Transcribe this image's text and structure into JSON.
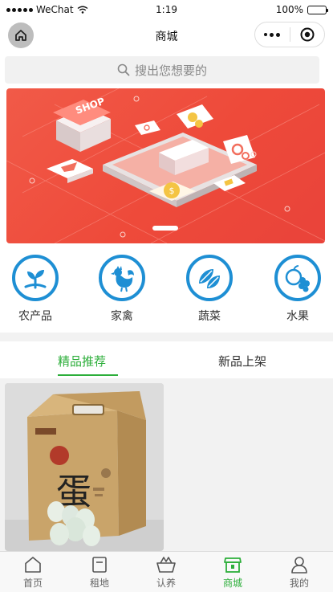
{
  "status_bar": {
    "carrier": "WeChat",
    "time": "1:19",
    "battery": "100%"
  },
  "nav": {
    "title": "商城"
  },
  "search": {
    "placeholder": "搜出您想要的"
  },
  "banner": {
    "sign_text": "SHOP",
    "page_count": 1,
    "active_page": 1
  },
  "categories": [
    {
      "label": "农产品",
      "icon": "sprout-icon"
    },
    {
      "label": "家禽",
      "icon": "rooster-icon"
    },
    {
      "label": "蔬菜",
      "icon": "vegetables-icon"
    },
    {
      "label": "水果",
      "icon": "fruit-icon"
    }
  ],
  "tabs": [
    {
      "label": "精品推荐",
      "active": true
    },
    {
      "label": "新品上架",
      "active": false
    }
  ],
  "product": {
    "box_text": "蛋"
  },
  "tabbar": [
    {
      "label": "首页",
      "icon": "home-icon",
      "active": false
    },
    {
      "label": "租地",
      "icon": "document-icon",
      "active": false
    },
    {
      "label": "认养",
      "icon": "basket-icon",
      "active": false
    },
    {
      "label": "商城",
      "icon": "store-icon",
      "active": true
    },
    {
      "label": "我的",
      "icon": "user-icon",
      "active": false
    }
  ],
  "colors": {
    "accent": "#2cae3a",
    "category_blue": "#1e8fd4",
    "banner_red": "#ee4a3a"
  }
}
